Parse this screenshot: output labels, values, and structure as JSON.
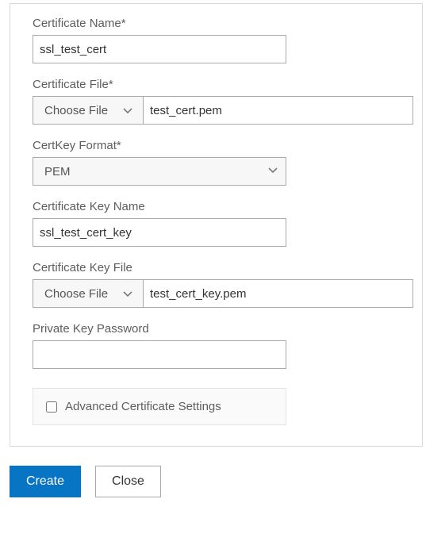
{
  "labels": {
    "certName": "Certificate Name*",
    "certFile": "Certificate File*",
    "format": "CertKey Format*",
    "keyName": "Certificate Key Name",
    "keyFile": "Certificate Key File",
    "pkPassword": "Private Key Password",
    "advanced": "Advanced Certificate Settings"
  },
  "values": {
    "certName": "ssl_test_cert",
    "certFile": "test_cert.pem",
    "format": "PEM",
    "keyName": "ssl_test_cert_key",
    "keyFile": "test_cert_key.pem",
    "pkPassword": ""
  },
  "fileButton": "Choose File",
  "actions": {
    "create": "Create",
    "close": "Close"
  }
}
